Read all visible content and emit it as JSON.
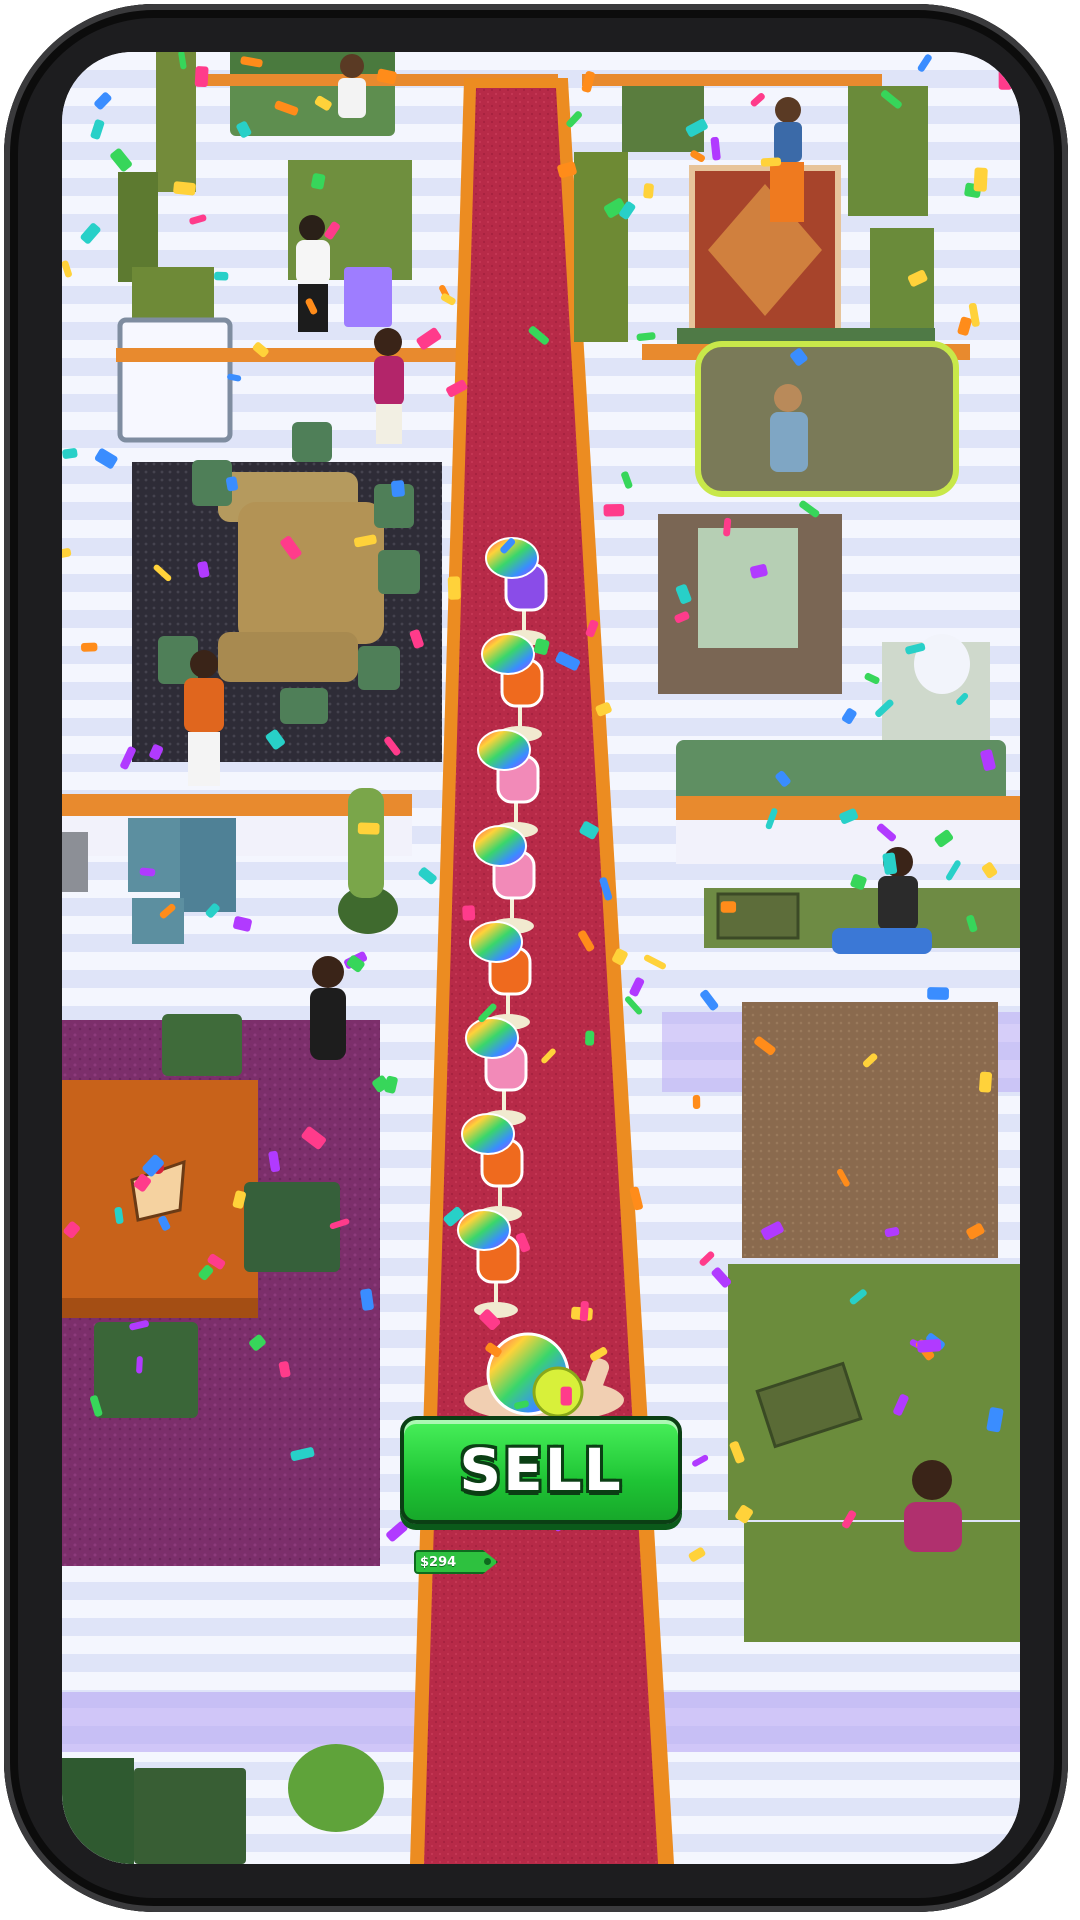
{
  "hud": {
    "sell_label": "SELL",
    "money_label": "$294"
  },
  "colors": {
    "carpet": "#b72a48",
    "carpet_border": "#ec8c21",
    "sell_button": "#2fd843",
    "floor": "#ecf0fb",
    "room_wall": "#e88a2e"
  },
  "drinks": {
    "stack_count": 9,
    "kinds": [
      "purple-juice",
      "orange-juice",
      "pink-juice",
      "pink-juice",
      "orange-juice",
      "pink-juice",
      "orange-juice",
      "orange-juice",
      "yellow-juice"
    ]
  },
  "icons": {
    "drink": "cocktail-glass-with-rainbow-umbrella",
    "confetti": "confetti-piece"
  }
}
